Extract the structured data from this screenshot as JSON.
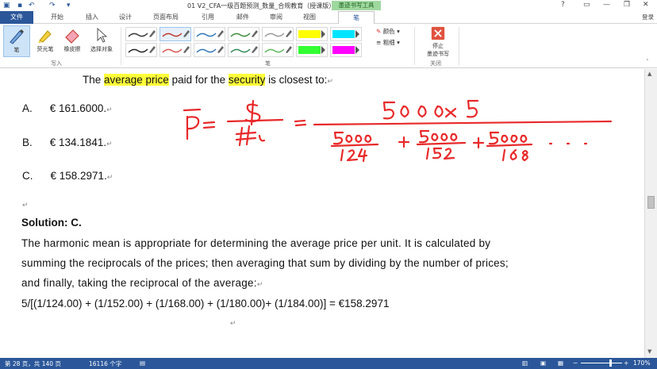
{
  "window": {
    "title": "01 V2_CFA一级百题预测_数量_合规教育（授课版） - Word",
    "contextual_tab_group": "墨迹书写工具",
    "help": "?",
    "login": "登录"
  },
  "tabs": [
    {
      "label": "文件"
    },
    {
      "label": "开始"
    },
    {
      "label": "插入"
    },
    {
      "label": "设计"
    },
    {
      "label": "页面布局"
    },
    {
      "label": "引用"
    },
    {
      "label": "邮件"
    },
    {
      "label": "审阅"
    },
    {
      "label": "视图"
    },
    {
      "label": "笔"
    }
  ],
  "ribbon": {
    "write_group": {
      "label": "写入",
      "buttons": [
        {
          "label": "笔",
          "icon": "pen-icon"
        },
        {
          "label": "荧光笔",
          "icon": "highlighter-icon"
        },
        {
          "label": "橡皮擦",
          "icon": "eraser-icon"
        },
        {
          "label": "选择对象",
          "icon": "select-arrow-icon"
        }
      ]
    },
    "pens_group": {
      "label": "笔",
      "color_label": "颜色",
      "thickness_label": "粗细",
      "swatches": [
        {
          "color": "#333333",
          "kind": "pen"
        },
        {
          "color": "#c0392b",
          "kind": "pen"
        },
        {
          "color": "#2e75b6",
          "kind": "pen"
        },
        {
          "color": "#3a8a3a",
          "kind": "pen"
        },
        {
          "color": "#999999",
          "kind": "pen"
        },
        {
          "color": "#ffff00",
          "kind": "highlighter"
        },
        {
          "color": "#00e5ff",
          "kind": "highlighter"
        },
        {
          "color": "#222222",
          "kind": "pen"
        },
        {
          "color": "#d9534f",
          "kind": "pen"
        },
        {
          "color": "#2e75b6",
          "kind": "pen"
        },
        {
          "color": "#2e8b57",
          "kind": "pen"
        },
        {
          "color": "#5cb85c",
          "kind": "pen"
        },
        {
          "color": "#33ff33",
          "kind": "highlighter"
        },
        {
          "color": "#ff00ff",
          "kind": "highlighter"
        }
      ]
    },
    "close_group": {
      "label": "关闭",
      "stop_label_line1": "停止",
      "stop_label_line2": "墨迹书写"
    }
  },
  "document": {
    "question_prefix": "The ",
    "question_hl1": "average price",
    "question_mid": " paid for the ",
    "question_hl2": "security",
    "question_suffix": " is closest to:",
    "options": [
      {
        "letter": "A.",
        "value": "€  161.6000."
      },
      {
        "letter": "B.",
        "value": "€  134.1841."
      },
      {
        "letter": "C.",
        "value": "€  158.2971."
      }
    ],
    "solution_heading": "Solution: C.",
    "solution_lines": [
      "The harmonic mean is appropriate for determining the average price per unit. It is calculated by",
      "summing the reciprocals of the prices; then averaging that sum by dividing by the number of prices;",
      "and finally, taking the reciprocal of the average:"
    ],
    "formula": "5/[(1/124.00) + (1/152.00) + (1/168.00) + (1/180.00)+ (1/184.00)] = €158.2971"
  },
  "statusbar": {
    "page": "第 28 页，共 140 页",
    "words": "16116 个字",
    "zoom": "170%"
  },
  "colors": {
    "accent": "#2b579a",
    "ink": "#e8292a",
    "highlight": "#ffff3a"
  }
}
